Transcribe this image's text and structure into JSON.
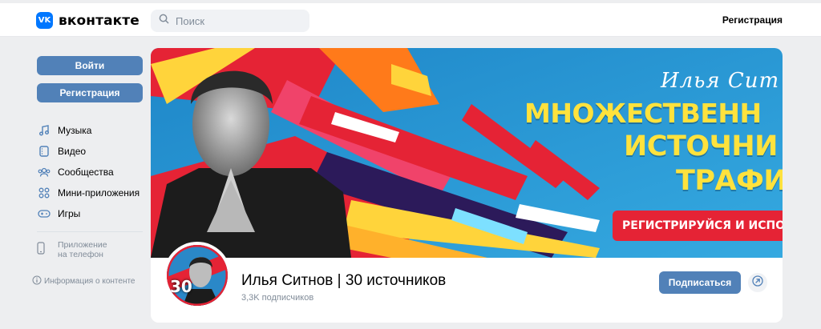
{
  "header": {
    "logo_text": "вконтакте",
    "logo_mark": "VK",
    "search_placeholder": "Поиск",
    "register_link": "Регистрация"
  },
  "sidebar": {
    "login_button": "Войти",
    "register_button": "Регистрация",
    "nav": [
      {
        "label": "Музыка",
        "icon": "music-icon"
      },
      {
        "label": "Видео",
        "icon": "video-icon"
      },
      {
        "label": "Сообщества",
        "icon": "communities-icon"
      },
      {
        "label": "Мини-приложения",
        "icon": "mini-apps-icon"
      },
      {
        "label": "Игры",
        "icon": "games-icon"
      }
    ],
    "app_line1": "Приложение",
    "app_line2": "на телефон",
    "info": "Информация о контенте"
  },
  "cover": {
    "signature": "Илья Сит",
    "line1": "МНОЖЕСТВЕНН",
    "line2": "ИСТОЧНИ",
    "line3": "ТРАФИ",
    "cta": "РЕГИСТРИРУЙСЯ И ИСПОЛ"
  },
  "profile": {
    "avatar_badge": "30",
    "name": "Илья Ситнов | 30 источников",
    "subscribers": "3,3K подписчиков",
    "subscribe_button": "Подписаться"
  },
  "colors": {
    "accent": "#5181b8",
    "vk_blue": "#0077ff",
    "background": "#edeef0",
    "cover_blue": "#2a9ad6",
    "cover_red": "#e52335",
    "cover_yellow": "#ffe23d"
  }
}
